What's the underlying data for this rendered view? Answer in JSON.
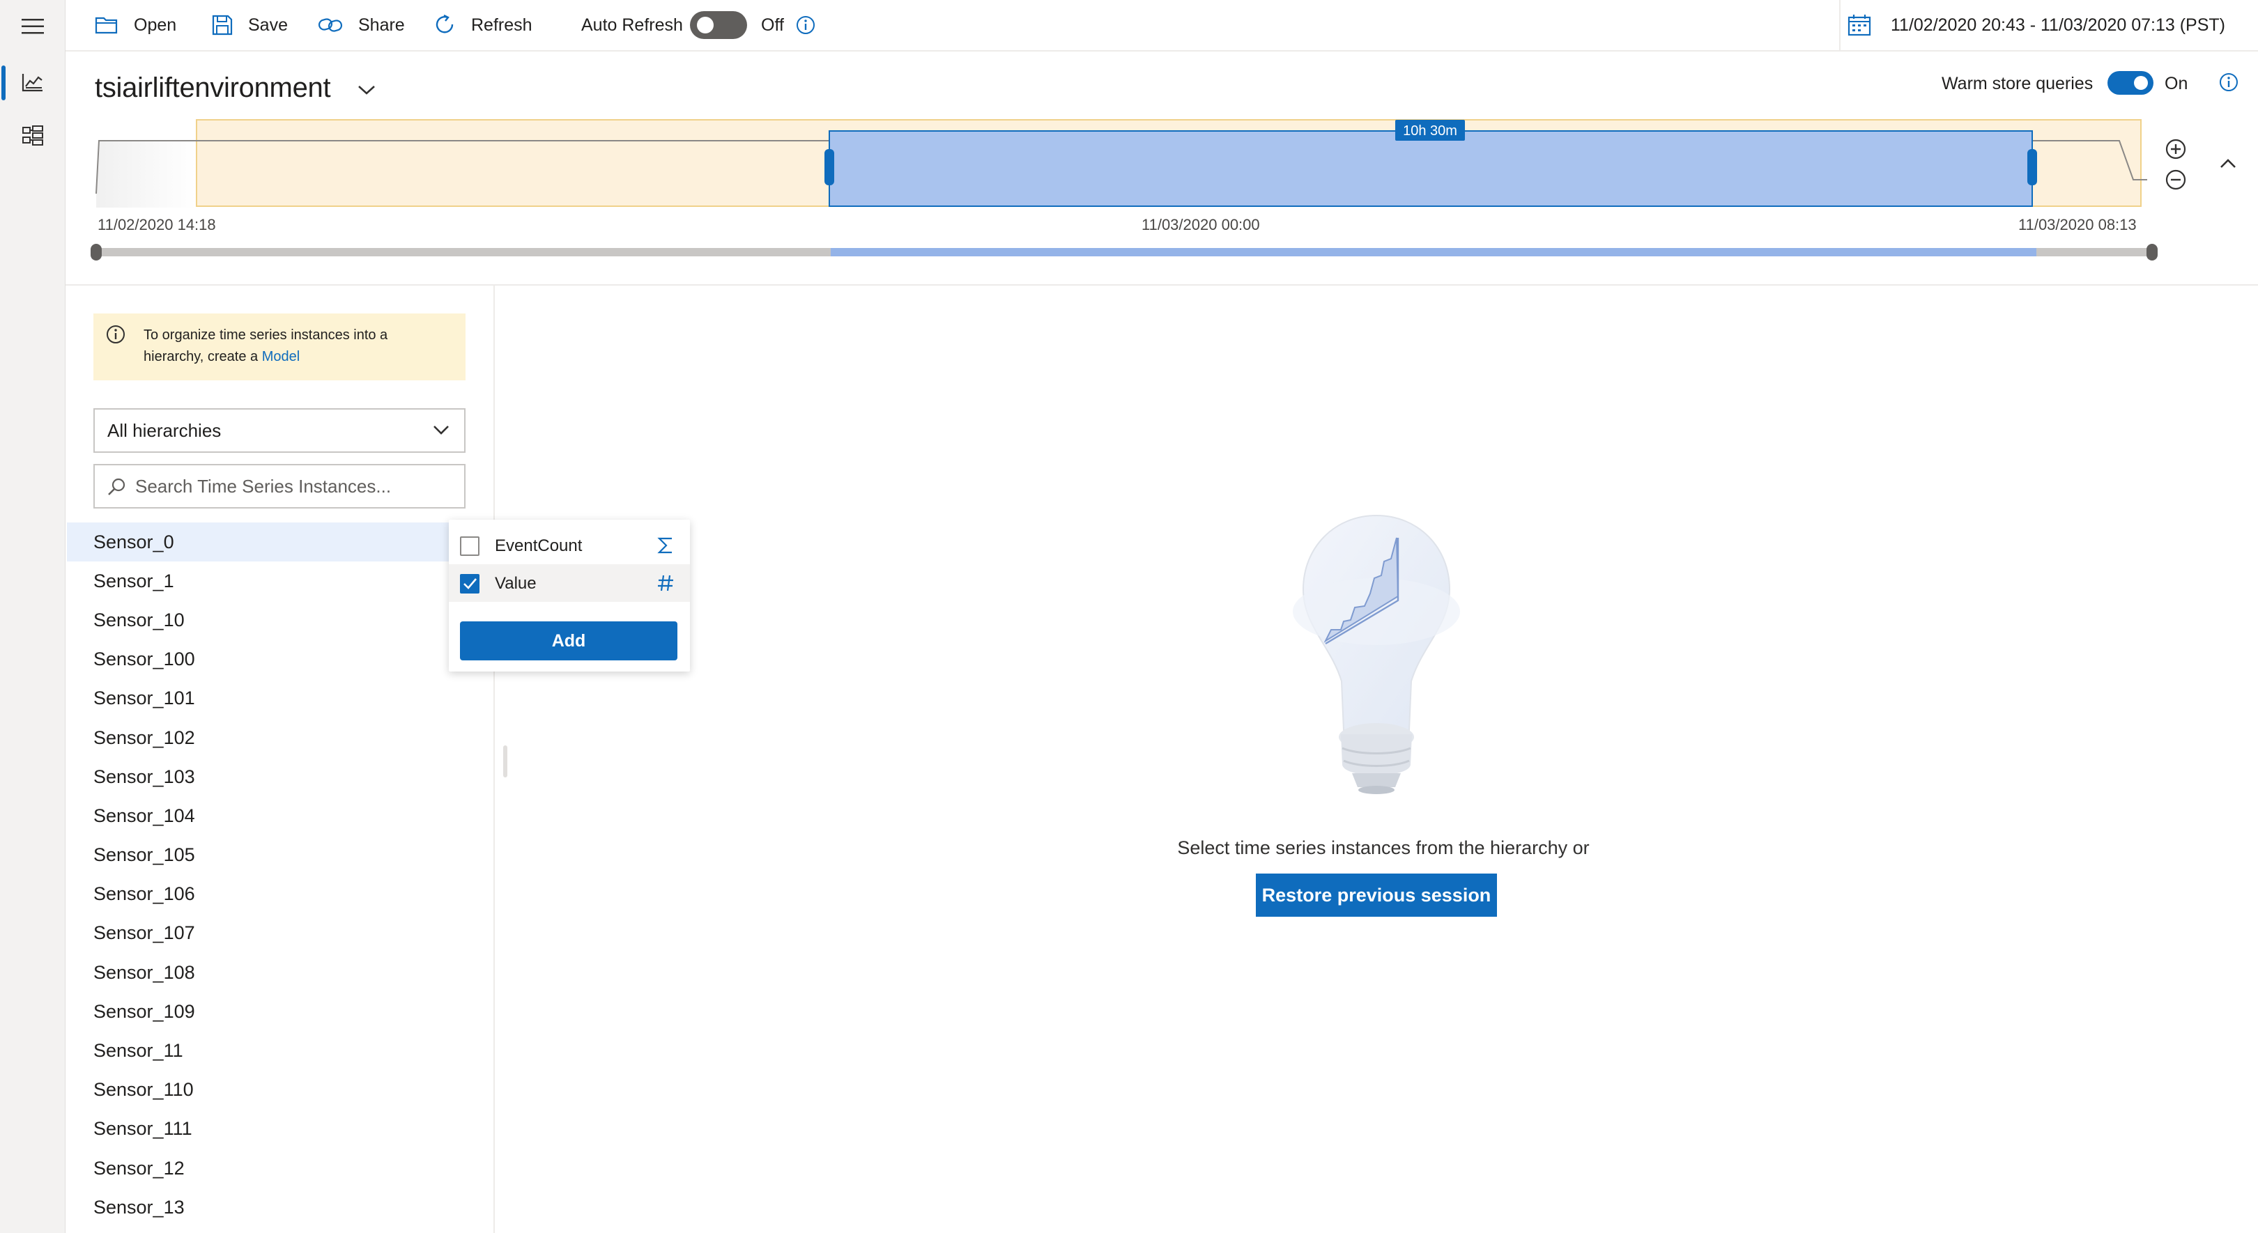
{
  "toolbar": {
    "open_label": "Open",
    "save_label": "Save",
    "share_label": "Share",
    "refresh_label": "Refresh",
    "auto_refresh_label": "Auto Refresh",
    "auto_refresh_state": "Off",
    "date_range": "11/02/2020 20:43 - 11/03/2020 07:13 (PST)"
  },
  "environment": {
    "name": "tsiairliftenvironment",
    "warm_store_label": "Warm store queries",
    "warm_store_state": "On"
  },
  "availability": {
    "selection_duration": "10h 30m",
    "axis_labels": [
      "11/02/2020 14:18",
      "11/03/2020 00:00",
      "11/03/2020 08:13"
    ]
  },
  "panel": {
    "model_note_text": "To organize time series instances into a hierarchy, create a",
    "model_note_link": "Model",
    "hierarchy_select": "All hierarchies",
    "search_placeholder": "Search Time Series Instances..."
  },
  "sensors": [
    "Sensor_0",
    "Sensor_1",
    "Sensor_10",
    "Sensor_100",
    "Sensor_101",
    "Sensor_102",
    "Sensor_103",
    "Sensor_104",
    "Sensor_105",
    "Sensor_106",
    "Sensor_107",
    "Sensor_108",
    "Sensor_109",
    "Sensor_11",
    "Sensor_110",
    "Sensor_111",
    "Sensor_12",
    "Sensor_13"
  ],
  "popover": {
    "variables": [
      {
        "label": "EventCount",
        "checked": false,
        "icon": "sigma-icon"
      },
      {
        "label": "Value",
        "checked": true,
        "icon": "hash-icon"
      }
    ],
    "add_label": "Add"
  },
  "empty_state": {
    "message": "Select time series instances from the hierarchy or",
    "restore_label": "Restore previous session"
  },
  "colors": {
    "accent": "#0f6cbd",
    "selection_fill": "#a9c3ee",
    "availability_band": "#fdf1dc",
    "note_bg": "#fdf3d4",
    "selected_row": "#e8f0fc"
  }
}
